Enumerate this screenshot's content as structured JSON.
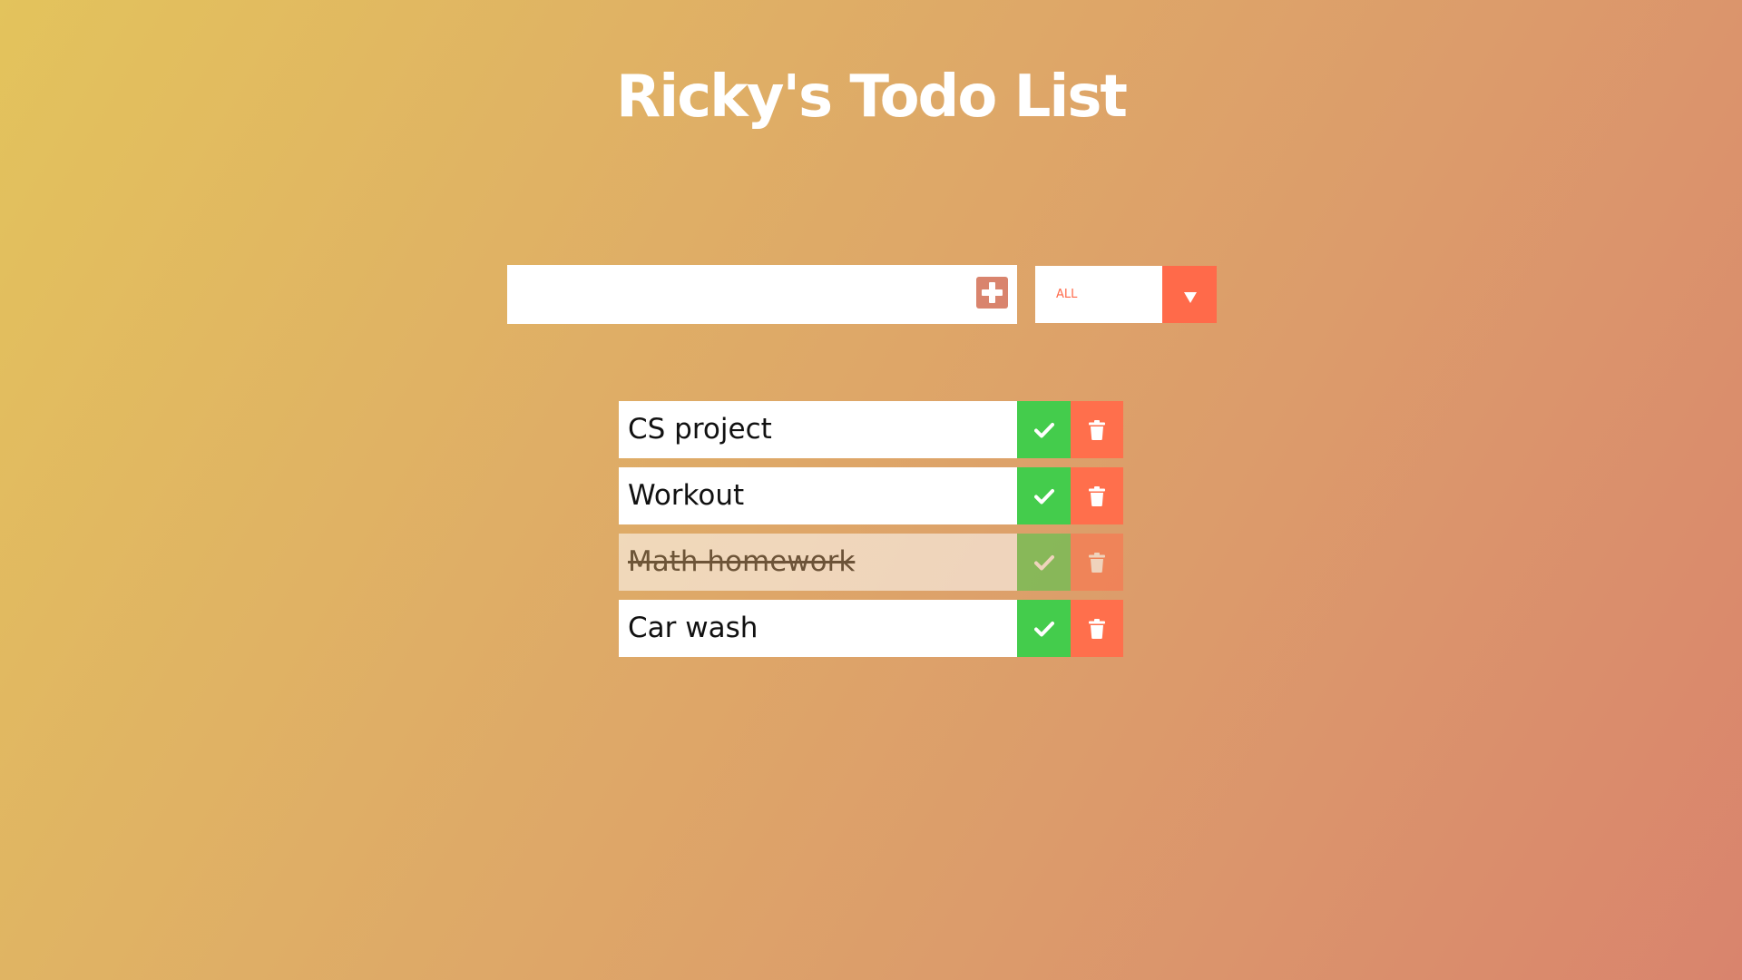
{
  "header": {
    "title": "Ricky's Todo List"
  },
  "input": {
    "value": "",
    "placeholder": ""
  },
  "filter": {
    "selected": "ALL"
  },
  "todos": [
    {
      "text": "CS project",
      "completed": false
    },
    {
      "text": "Workout",
      "completed": false
    },
    {
      "text": "Math homework",
      "completed": true
    },
    {
      "text": "Car wash",
      "completed": false
    }
  ],
  "icons": {
    "add": "plus-square-icon",
    "filter_arrow": "caret-down-icon",
    "complete": "check-icon",
    "delete": "trash-icon"
  },
  "colors": {
    "accent": "#ff6a4a",
    "complete": "#44cc4c",
    "add_button": "#d9846d",
    "title": "#ffffff"
  }
}
